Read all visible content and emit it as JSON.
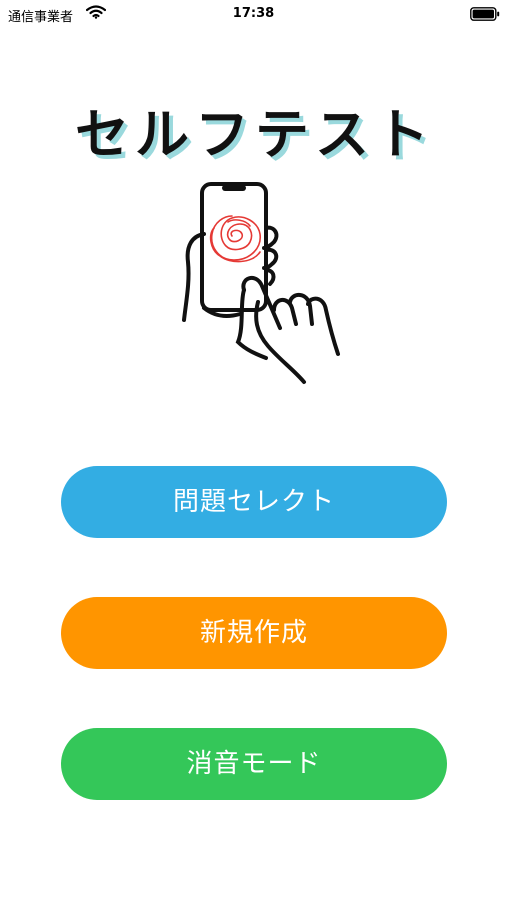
{
  "status_bar": {
    "carrier": "通信事業者",
    "time": "17:38",
    "wifi_icon": "wifi-icon",
    "battery_icon": "battery-icon"
  },
  "app": {
    "title": "セルフテスト",
    "illustration_icon": "hand-holding-phone-icon"
  },
  "menu": {
    "items": [
      {
        "label": "問題セレクト",
        "color": "#33ade3"
      },
      {
        "label": "新規作成",
        "color": "#ff9500"
      },
      {
        "label": "消音モード",
        "color": "#34c759"
      }
    ]
  }
}
